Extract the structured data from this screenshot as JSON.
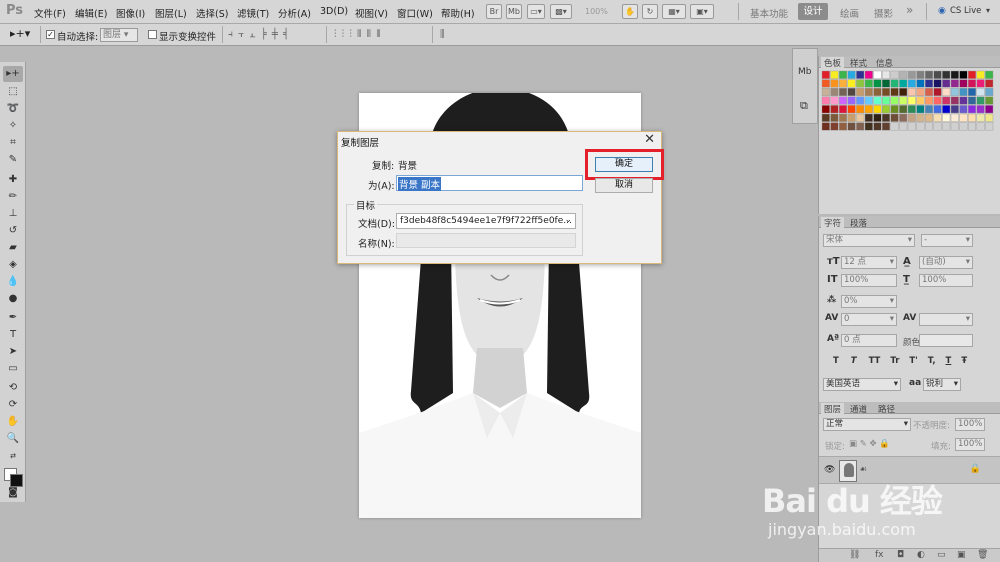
{
  "menubar": {
    "logo": "Ps",
    "items": [
      "文件(F)",
      "编辑(E)",
      "图像(I)",
      "图层(L)",
      "选择(S)",
      "滤镜(T)",
      "分析(A)",
      "3D(D)",
      "视图(V)",
      "窗口(W)",
      "帮助(H)"
    ],
    "zoom": "100%",
    "workspaces": [
      "基本功能",
      "设计",
      "绘画",
      "摄影"
    ],
    "more": "»",
    "cslive": "CS Live"
  },
  "options": {
    "auto_select_label": "自动选择:",
    "auto_select_value": "图层",
    "show_transform_label": "显示变换控件"
  },
  "dialog": {
    "title": "复制图层",
    "close": "✕",
    "copy_label": "复制:",
    "copy_value": "背景",
    "as_label": "为(A):",
    "as_value": "背景 副本",
    "target_legend": "目标",
    "doc_label": "文档(D):",
    "doc_value": "f3deb48f8c5494ee1e7f9f722ff5e0fe...",
    "name_label": "名称(N):",
    "name_value": "",
    "ok": "确定",
    "cancel": "取消"
  },
  "panels": {
    "color_tabs": [
      "色板",
      "样式",
      "信息"
    ],
    "char_tabs": [
      "字符",
      "段落"
    ],
    "font_family": "宋体",
    "font_style": "-",
    "font_size": "12 点",
    "leading": "(自动)",
    "scale_v": "100%",
    "scale_h": "100%",
    "baseline_pct": "0%",
    "tracking": "0",
    "kerning": "",
    "baseline_shift": "0 点",
    "color_label": "颜色:",
    "style_buttons": [
      "T",
      "T",
      "TT",
      "Tr",
      "T'",
      "T,",
      "T",
      "Ŧ"
    ],
    "language": "美国英语",
    "aa_label": "aa",
    "aa_value": "锐利",
    "layers_tabs": [
      "图层",
      "通道",
      "路径"
    ],
    "blend_mode": "正常",
    "opacity_label": "不透明度:",
    "opacity": "100%",
    "lock_label": "锁定:",
    "fill_label": "填充:",
    "fill": "100%"
  },
  "watermark": {
    "logo": "Bai du 经验",
    "url": "jingyan.baidu.com"
  },
  "colors": {
    "accent_highlight": "#e4202b",
    "selection": "#3a76c8"
  }
}
